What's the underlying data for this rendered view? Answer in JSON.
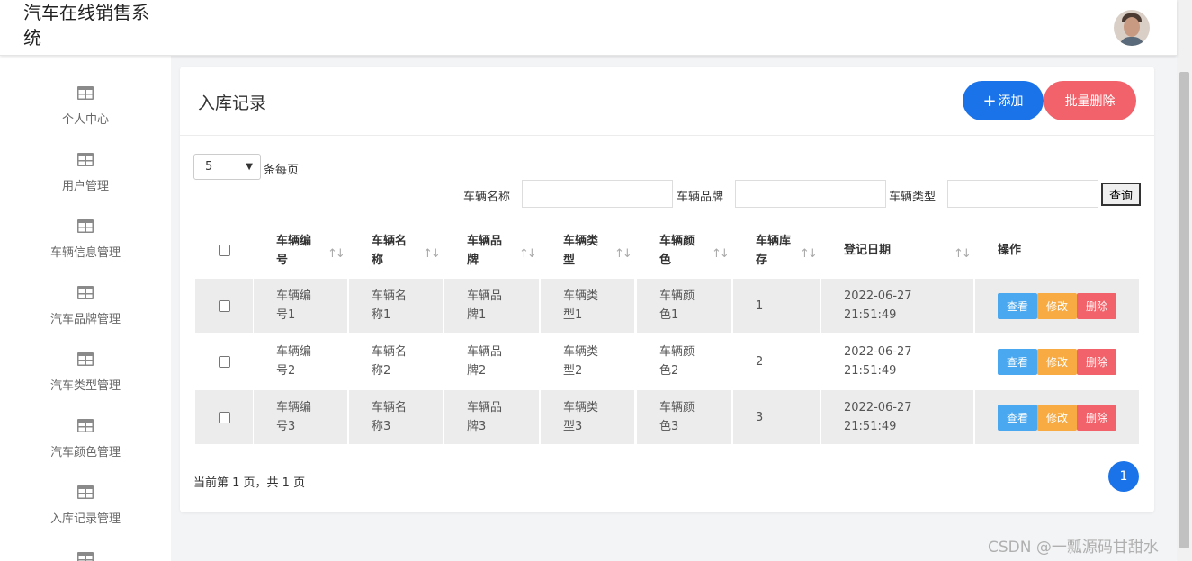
{
  "header": {
    "title": "汽车在线销售系统"
  },
  "sidebar": {
    "items": [
      {
        "label": "个人中心"
      },
      {
        "label": "用户管理"
      },
      {
        "label": "车辆信息管理"
      },
      {
        "label": "汽车品牌管理"
      },
      {
        "label": "汽车类型管理"
      },
      {
        "label": "汽车颜色管理"
      },
      {
        "label": "入库记录管理"
      }
    ]
  },
  "card": {
    "title": "入库记录",
    "add_label": "添加",
    "batch_delete_label": "批量删除"
  },
  "pagesize": {
    "value": "5",
    "label": "条每页"
  },
  "filters": {
    "name_label": "车辆名称",
    "brand_label": "车辆品牌",
    "type_label": "车辆类型",
    "query_label": "查询"
  },
  "table": {
    "columns": [
      "车辆编号",
      "车辆名称",
      "车辆品牌",
      "车辆类型",
      "车辆颜色",
      "车辆库存",
      "登记日期",
      "操作"
    ],
    "rows": [
      {
        "code": "车辆编号1",
        "name": "车辆名称1",
        "brand": "车辆品牌1",
        "type": "车辆类型1",
        "color": "车辆颜色1",
        "stock": "1",
        "date": "2022-06-27 21:51:49"
      },
      {
        "code": "车辆编号2",
        "name": "车辆名称2",
        "brand": "车辆品牌2",
        "type": "车辆类型2",
        "color": "车辆颜色2",
        "stock": "2",
        "date": "2022-06-27 21:51:49"
      },
      {
        "code": "车辆编号3",
        "name": "车辆名称3",
        "brand": "车辆品牌3",
        "type": "车辆类型3",
        "color": "车辆颜色3",
        "stock": "3",
        "date": "2022-06-27 21:51:49"
      }
    ],
    "actions": {
      "view": "查看",
      "edit": "修改",
      "delete": "删除"
    }
  },
  "pager": {
    "summary": "当前第 1 页，共 1 页",
    "current": "1"
  },
  "watermark": "CSDN @一瓢源码甘甜水",
  "colors": {
    "primary": "#1a73e8",
    "danger": "#f2626a",
    "warning": "#f9ab43",
    "info": "#4aa8f0"
  }
}
